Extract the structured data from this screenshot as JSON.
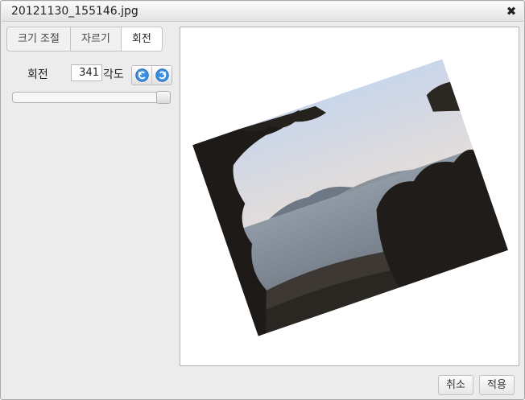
{
  "window": {
    "title": "20121130_155146.jpg"
  },
  "tabs": [
    {
      "label": "크기 조절"
    },
    {
      "label": "자르기"
    },
    {
      "label": "회전"
    }
  ],
  "rotate": {
    "label": "회전",
    "angle": "341",
    "unit": "각도",
    "slider_fraction": 0.947
  },
  "buttons": {
    "cancel": "취소",
    "apply": "적용"
  },
  "colors": {
    "accent_icon": "#2a7fd4",
    "dialog_bg": "#ececec"
  },
  "icons": {
    "close": "close-icon",
    "rotate_left": "rotate-left-icon",
    "rotate_right": "rotate-right-icon"
  }
}
